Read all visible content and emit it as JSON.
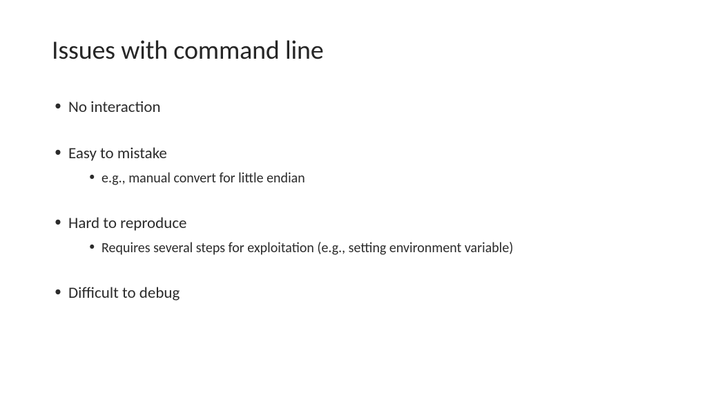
{
  "title": "Issues with command line",
  "bullets": [
    {
      "text": "No interaction",
      "sub": []
    },
    {
      "text": "Easy to mistake",
      "sub": [
        "e.g., manual convert for little endian"
      ]
    },
    {
      "text": "Hard to reproduce",
      "sub": [
        "Requires several steps for exploitation (e.g., setting environment variable)"
      ]
    },
    {
      "text": "Difficult to debug",
      "sub": []
    }
  ]
}
